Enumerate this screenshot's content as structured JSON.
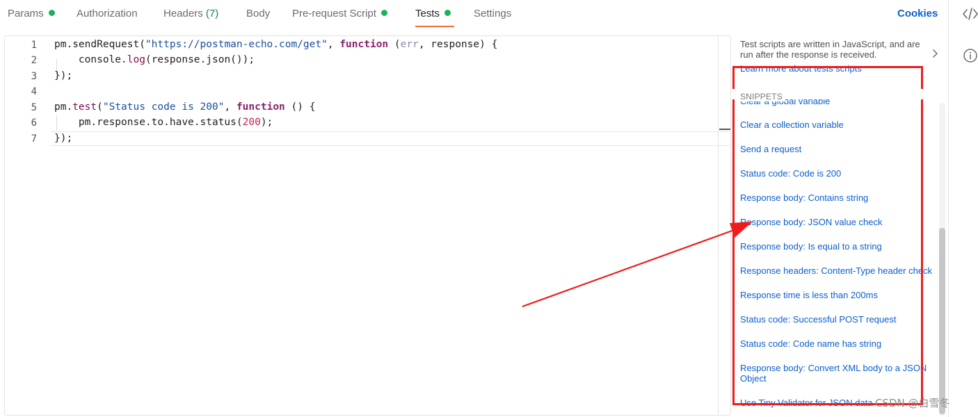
{
  "tabs": {
    "params": "Params",
    "authorization": "Authorization",
    "headers": "Headers",
    "headers_count": "(7)",
    "body": "Body",
    "prerequest": "Pre-request Script",
    "tests": "Tests",
    "settings": "Settings",
    "cookies": "Cookies",
    "active_tab": "Tests",
    "status_dot_color": "#1fb15a"
  },
  "editor": {
    "line_numbers": [
      "1",
      "2",
      "3",
      "4",
      "5",
      "6",
      "7"
    ],
    "lines": {
      "l1_a": "pm.sendRequest(",
      "l1_str": "\"https://postman-echo.com/get\"",
      "l1_b": ", ",
      "l1_kw": "function",
      "l1_c": " (",
      "l1_p1": "err",
      "l1_d": ", response) {",
      "l2_a": "    console.",
      "l2_fn": "log",
      "l2_b": "(response.json());",
      "l3": "});",
      "l5_a": "pm.",
      "l5_fn": "test",
      "l5_b": "(",
      "l5_str": "\"Status code is 200\"",
      "l5_c": ", ",
      "l5_kw": "function",
      "l5_d": " () {",
      "l6_a": "    pm.response.to.have.status(",
      "l6_num": "200",
      "l6_b": ");",
      "l7": "});"
    }
  },
  "panel": {
    "description": "Test scripts are written in JavaScript, and are run after the response is received.",
    "learn_more": "Learn more about tests scripts",
    "snippets_header": "SNIPPETS",
    "snippet_partial": "Clear a global variable",
    "snippets": [
      "Clear a collection variable",
      "Send a request",
      "Status code: Code is 200",
      "Response body: Contains string",
      "Response body: JSON value check",
      "Response body: Is equal to a string",
      "Response headers: Content-Type header check",
      "Response time is less than 200ms",
      "Status code: Successful POST request",
      "Status code: Code name has string",
      "Response body: Convert XML body to a JSON Object",
      "Use Tiny Validator for JSON data"
    ]
  },
  "rail": {
    "icons": [
      "code-icon",
      "info-icon"
    ]
  },
  "annotation": {
    "color": "#ee1c1c"
  },
  "watermark": "CSDN @白雪冬"
}
